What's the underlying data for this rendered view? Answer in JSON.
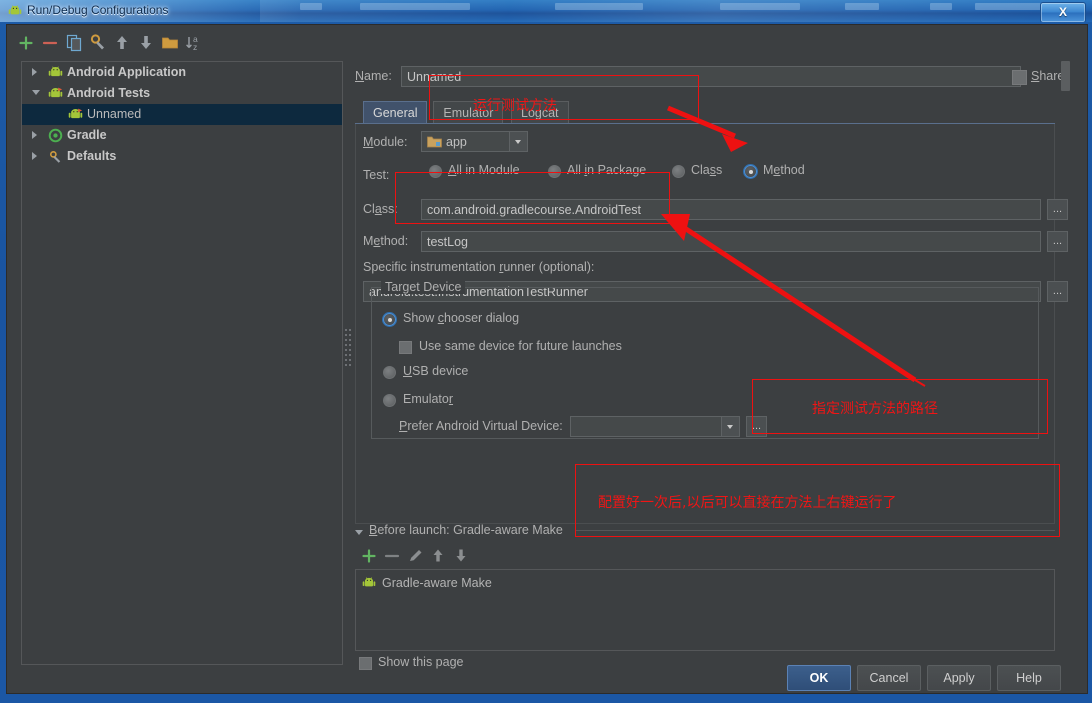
{
  "window": {
    "title": "Run/Debug Configurations",
    "close_label": "X",
    "app_icon": "android-icon"
  },
  "toolbar": {
    "items": [
      {
        "name": "add-configuration-button",
        "icon": "plus-icon",
        "label": "+"
      },
      {
        "name": "remove-configuration-button",
        "icon": "minus-icon",
        "label": "−"
      },
      {
        "name": "copy-configuration-button",
        "icon": "copy-icon",
        "label": "Copy"
      },
      {
        "name": "edit-defaults-button",
        "icon": "wrench-icon",
        "label": "Edit defaults"
      },
      {
        "name": "move-up-button",
        "icon": "arrow-up-icon",
        "label": "Move Up"
      },
      {
        "name": "move-down-button",
        "icon": "arrow-down-icon",
        "label": "Move Down"
      },
      {
        "name": "create-folder-button",
        "icon": "folder-icon",
        "label": "Create Folder"
      },
      {
        "name": "sort-alphabetically-button",
        "icon": "sort-az-icon",
        "label": "Sort Configurations"
      }
    ]
  },
  "tree": {
    "items": [
      {
        "label": "Android Application",
        "icon": "android-icon",
        "expander": "closed",
        "indent": 0,
        "selected": false
      },
      {
        "label": "Android Tests",
        "icon": "android-test-icon",
        "expander": "open",
        "indent": 0,
        "selected": false
      },
      {
        "label": "Unnamed",
        "icon": "android-test-icon",
        "expander": "none",
        "indent": 1,
        "selected": true
      },
      {
        "label": "Gradle",
        "icon": "gradle-icon",
        "expander": "closed",
        "indent": 0,
        "selected": false
      },
      {
        "label": "Defaults",
        "icon": "wrench-icon",
        "expander": "closed",
        "indent": 0,
        "selected": false
      }
    ]
  },
  "form": {
    "name_label": "Name:",
    "name_value": "Unnamed",
    "share_label": "Share",
    "share_checked": false,
    "tabs": [
      {
        "label": "General",
        "active": true
      },
      {
        "label": "Emulator",
        "active": false
      },
      {
        "label": "Logcat",
        "active": false
      }
    ],
    "module_label": "Module:",
    "module_value": "app",
    "module_icon": "module-folder-icon",
    "test_label": "Test:",
    "test_options": [
      {
        "label": "All in Module",
        "selected": false
      },
      {
        "label": "All in Package",
        "selected": false
      },
      {
        "label": "Class",
        "selected": false
      },
      {
        "label": "Method",
        "selected": true
      }
    ],
    "class_label": "Class:",
    "class_value": "com.android.gradlecourse.AndroidTest",
    "method_label": "Method:",
    "method_value": "testLog",
    "runner_label": "Specific instrumentation runner (optional):",
    "runner_value": "android.test.InstrumentationTestRunner",
    "browse_label": "...",
    "target_device": {
      "legend": "Target Device",
      "options": [
        {
          "label": "Show chooser dialog",
          "selected": true
        },
        {
          "label": "USB device",
          "selected": false
        },
        {
          "label": "Emulator",
          "selected": false
        }
      ],
      "use_same_device_label": "Use same device for future launches",
      "use_same_device_checked": false,
      "avd_label": "Prefer Android Virtual Device:",
      "avd_value": ""
    },
    "before_launch": {
      "title": "Before launch: Gradle-aware Make",
      "buttons": [
        {
          "name": "add-task-button",
          "icon": "plus-icon"
        },
        {
          "name": "remove-task-button",
          "icon": "minus-icon"
        },
        {
          "name": "edit-task-button",
          "icon": "pencil-icon"
        },
        {
          "name": "move-task-up-button",
          "icon": "arrow-up-icon"
        },
        {
          "name": "move-task-down-button",
          "icon": "arrow-down-icon"
        }
      ],
      "tasks": [
        {
          "label": "Gradle-aware Make",
          "icon": "android-icon"
        }
      ]
    },
    "show_page_label": "Show this page",
    "show_page_checked": false
  },
  "buttons": {
    "ok": "OK",
    "cancel": "Cancel",
    "apply": "Apply",
    "help": "Help"
  },
  "annotations": {
    "color": "#ee1111",
    "notes": [
      {
        "name": "annotation-run-test-method",
        "text": "运行测试方法"
      },
      {
        "name": "annotation-test-method-path",
        "text": "指定测试方法的路径"
      },
      {
        "name": "annotation-configure-once",
        "text": "配置好一次后,以后可以直接在方法上右键运行了"
      }
    ]
  }
}
